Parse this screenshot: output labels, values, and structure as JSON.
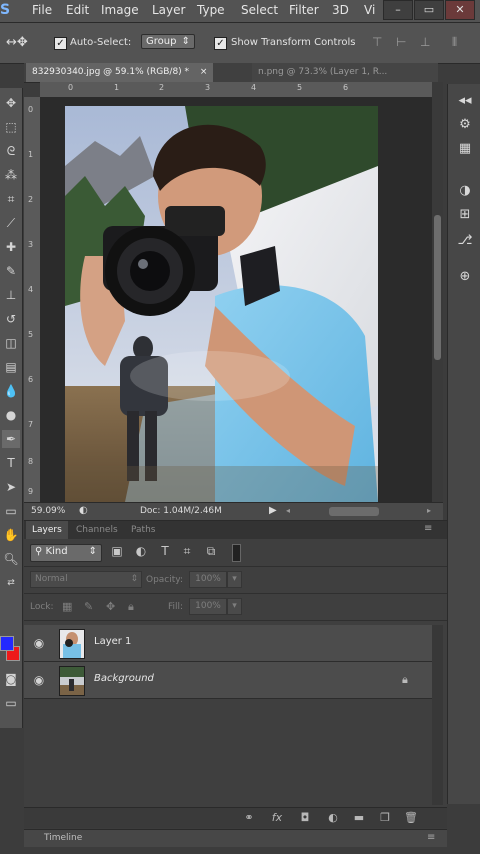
{
  "menubar": {
    "logo": "S",
    "items": [
      "File",
      "Edit",
      "Image",
      "Layer",
      "Type",
      "Select",
      "Filter",
      "3D",
      "Vi"
    ],
    "window_buttons": [
      "–",
      "▭",
      "✕"
    ]
  },
  "options": {
    "auto_select_label": "Auto-Select:",
    "auto_select_value": "Group",
    "transform_label": "Show Transform Controls"
  },
  "tabs": [
    {
      "label": "832930340.jpg @ 59.1% (RGB/8) *",
      "close": "×"
    },
    {
      "label": "n.png @ 73.3% (Layer 1, R..."
    }
  ],
  "rulers": {
    "top": [
      "0",
      "1",
      "2",
      "3",
      "4",
      "5",
      "6"
    ],
    "left": [
      "0",
      "1",
      "2",
      "3",
      "4",
      "5",
      "6",
      "7",
      "8",
      "9"
    ]
  },
  "status": {
    "zoom": "59.09%",
    "doc": "Doc: 1.04M/2.46M"
  },
  "layers_panel": {
    "tabs": [
      "Layers",
      "Channels",
      "Paths"
    ],
    "filter_kind": "Kind",
    "blend_mode": "Normal",
    "opacity_label": "Opacity:",
    "opacity_value": "100%",
    "lock_label": "Lock:",
    "fill_label": "Fill:",
    "fill_value": "100%",
    "layers": [
      {
        "name": "Layer 1",
        "locked": false
      },
      {
        "name": "Background",
        "locked": true
      }
    ],
    "footer_icons": [
      "link-icon",
      "fx-icon",
      "mask-icon",
      "adjustment-icon",
      "folder-icon",
      "new-layer-icon",
      "trash-icon"
    ]
  },
  "timeline_label": "Timeline",
  "colors": {
    "foreground": "#2328ff",
    "background": "#ee1919",
    "ui_bg": "#535353"
  }
}
